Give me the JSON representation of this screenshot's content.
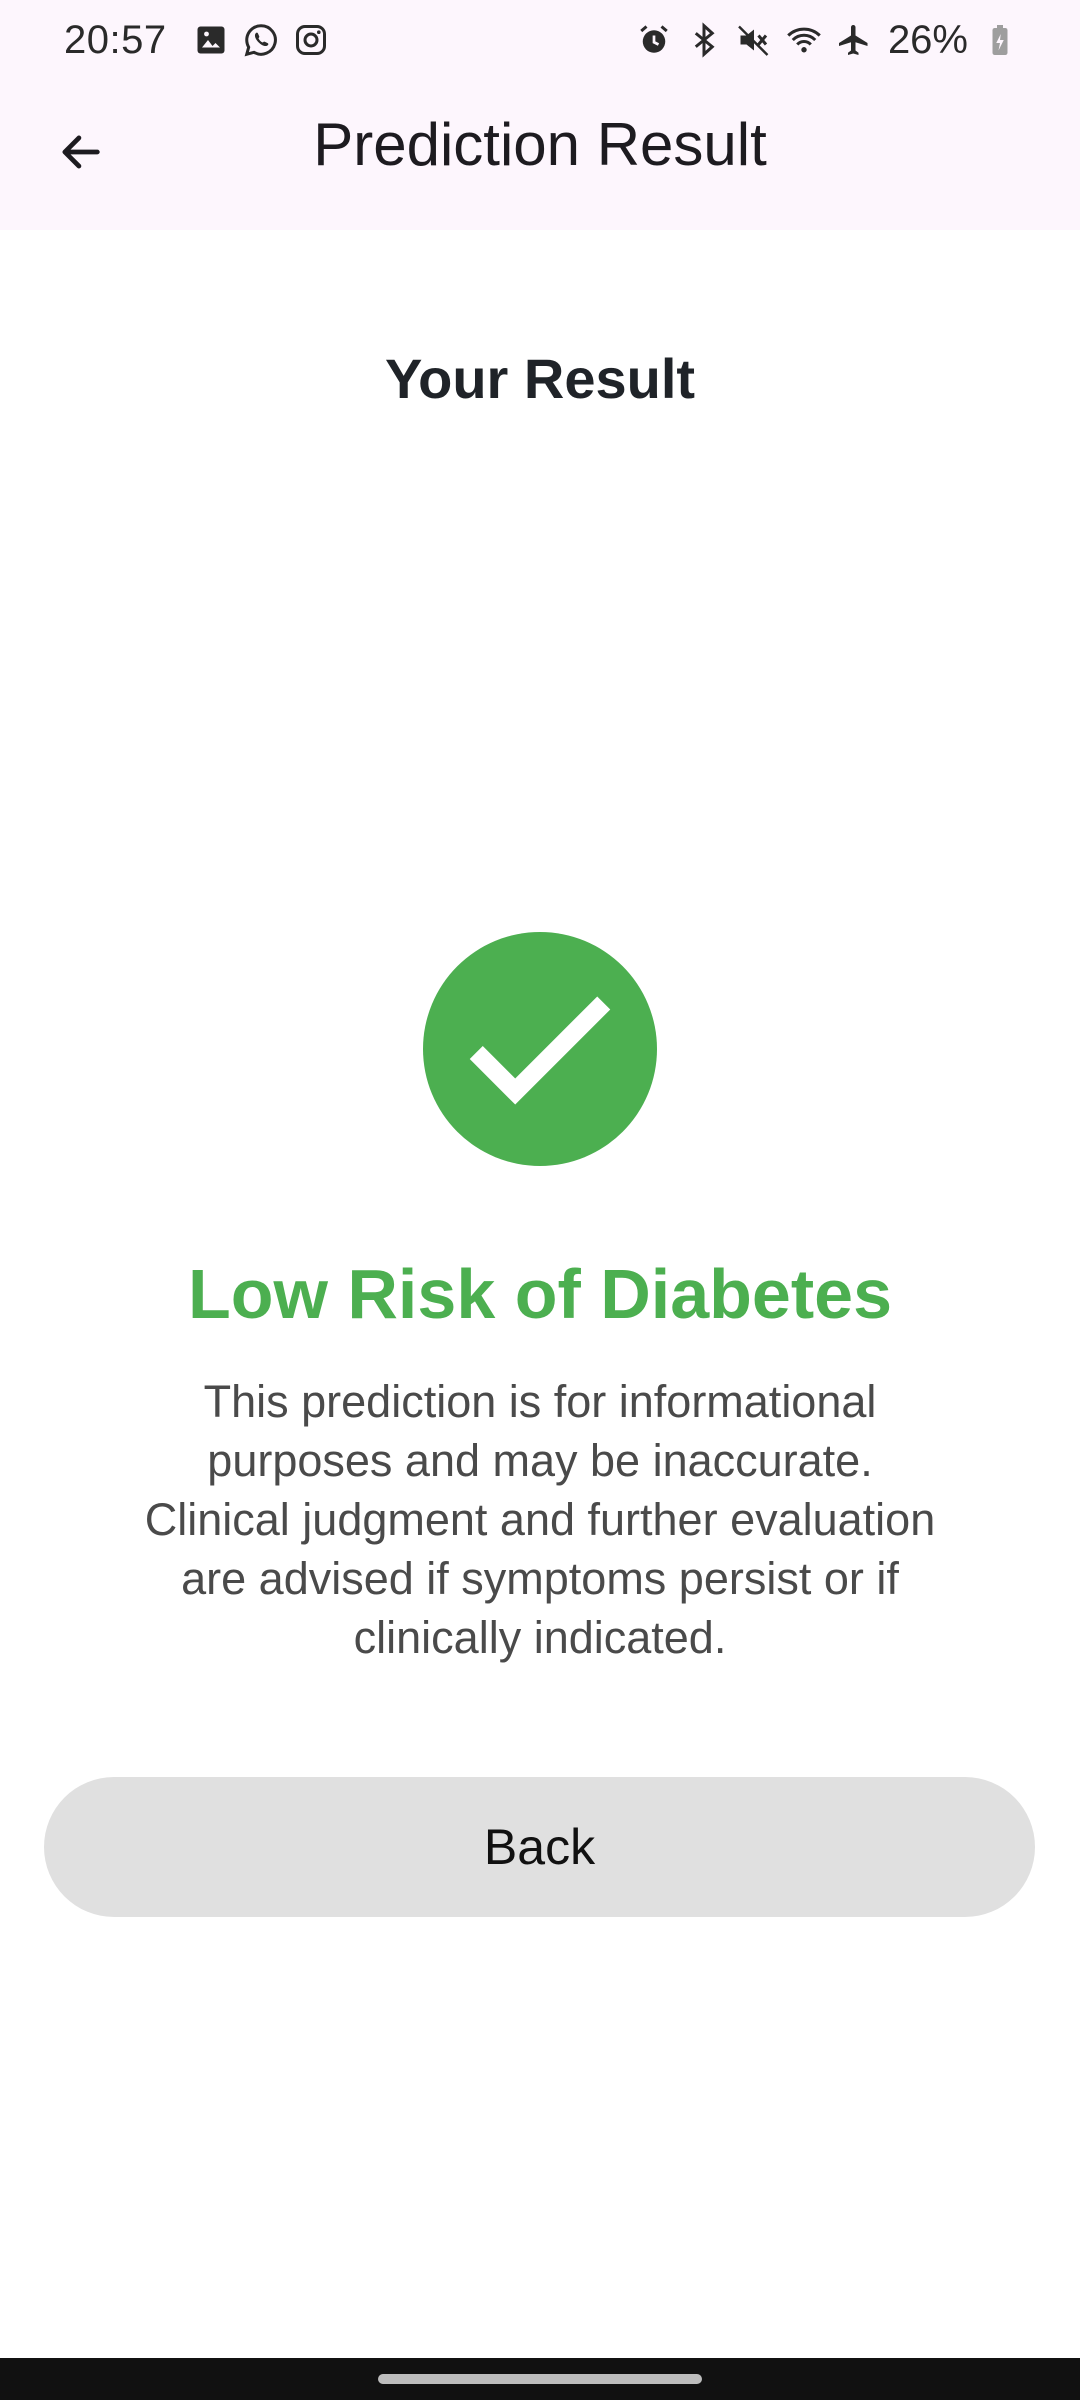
{
  "status_bar": {
    "time": "20:57",
    "left_icons": [
      "gallery-icon",
      "whatsapp-icon",
      "instagram-icon"
    ],
    "right_icons": [
      "alarm-icon",
      "bluetooth-icon",
      "mute-icon",
      "wifi-icon",
      "airplane-icon",
      "battery-icon"
    ],
    "battery": "26%"
  },
  "app_bar": {
    "title": "Prediction Result",
    "back_icon": "arrow-left-icon"
  },
  "main": {
    "heading": "Your Result",
    "result_icon": "check-circle-icon",
    "result_title": "Low Risk of Diabetes",
    "disclaimer": "This prediction is for informational purposes and may be inaccurate. Clinical judgment and further evaluation are advised if symptoms persist or if clinically indicated.",
    "back_button": "Back"
  },
  "colors": {
    "accent_green": "#4caf50",
    "app_bar_bg": "#fdf6fd",
    "button_bg": "#e0e0e0"
  }
}
